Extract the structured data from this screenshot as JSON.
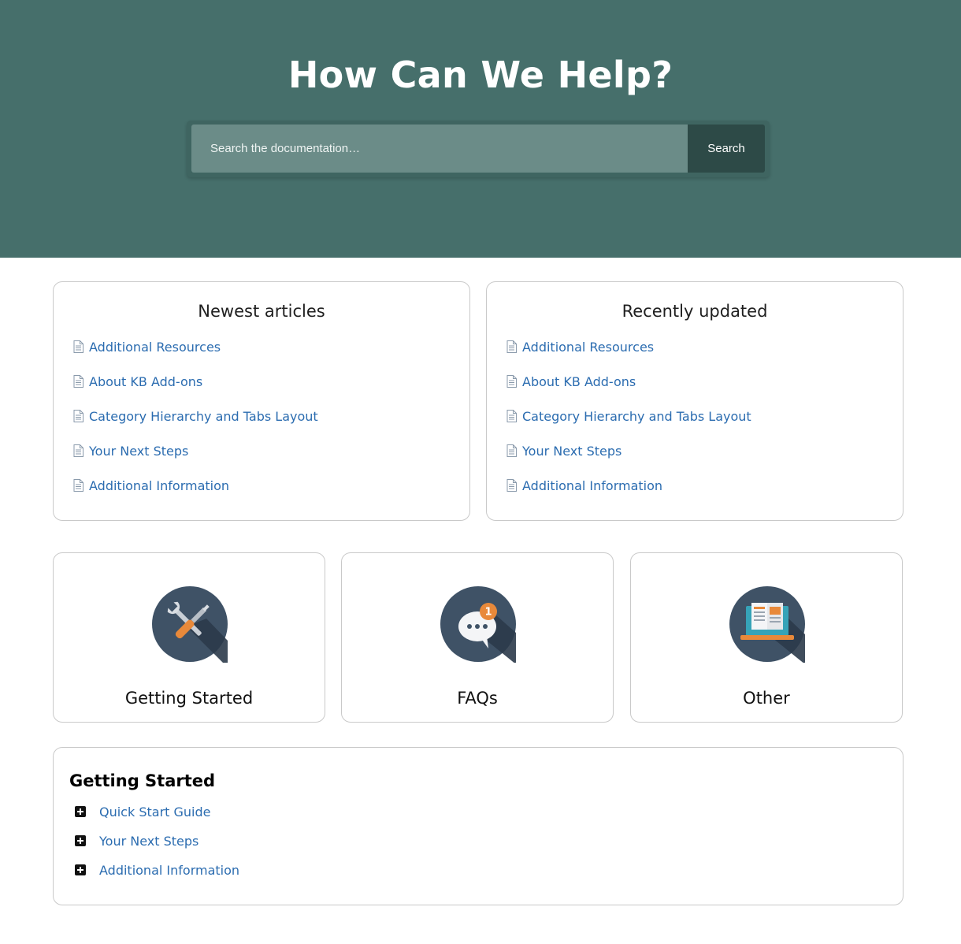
{
  "hero": {
    "title": "How Can We Help?",
    "search_placeholder": "Search the documentation…",
    "search_button": "Search",
    "background_color": "#466f6b"
  },
  "newest": {
    "title": "Newest articles",
    "items": [
      {
        "label": "Additional Resources"
      },
      {
        "label": "About KB Add-ons"
      },
      {
        "label": "Category Hierarchy and Tabs Layout"
      },
      {
        "label": "Your Next Steps"
      },
      {
        "label": "Additional Information"
      }
    ]
  },
  "recent": {
    "title": "Recently updated",
    "items": [
      {
        "label": "Additional Resources"
      },
      {
        "label": "About KB Add-ons"
      },
      {
        "label": "Category Hierarchy and Tabs Layout"
      },
      {
        "label": "Your Next Steps"
      },
      {
        "label": "Additional Information"
      }
    ]
  },
  "categories": [
    {
      "label": "Getting Started",
      "icon": "tools-icon"
    },
    {
      "label": "FAQs",
      "icon": "chat-bubble-icon",
      "badge": "1"
    },
    {
      "label": "Other",
      "icon": "laptop-book-icon"
    }
  ],
  "section": {
    "title": "Getting Started",
    "items": [
      {
        "label": "Quick Start Guide"
      },
      {
        "label": "Your Next Steps"
      },
      {
        "label": "Additional Information"
      }
    ]
  },
  "colors": {
    "link": "#2b6cb0",
    "icon_circle": "#3f5266",
    "accent_orange": "#e8893a"
  }
}
